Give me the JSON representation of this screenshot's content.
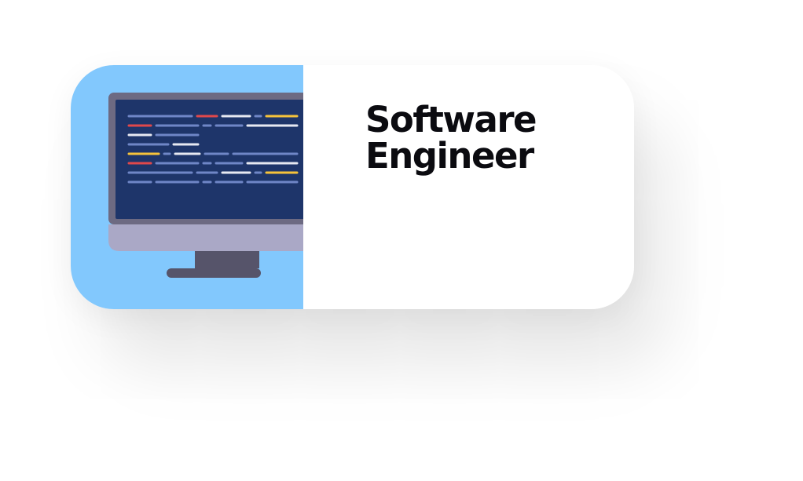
{
  "card": {
    "title_line1": "Software",
    "title_line2": "Engineer"
  },
  "colors": {
    "accent_panel": "#82c8fd",
    "screen": "#1e356a",
    "bezel": "#6d6a82",
    "monitor_base": "#aaa8c6",
    "stand": "#56546a",
    "code_blue": "#6f86c7",
    "code_red": "#e0484b",
    "code_yellow": "#f6c33b",
    "code_white": "#e7e9f2"
  },
  "icons": {
    "illustration": "desktop-monitor-code-icon"
  }
}
